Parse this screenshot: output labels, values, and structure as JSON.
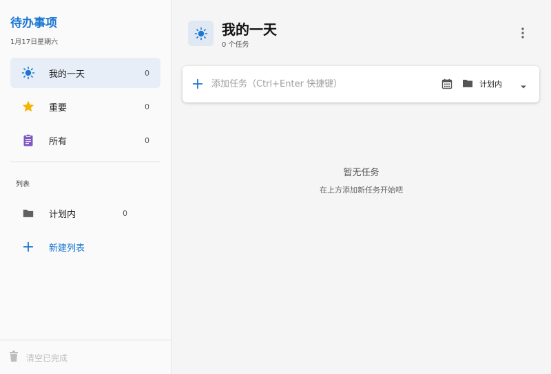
{
  "app": {
    "title": "待办事项",
    "date": "1月17日星期六"
  },
  "colors": {
    "accent": "#1976d2",
    "star": "#f5b400",
    "clipboard": "#7e57c2",
    "folder": "#616161",
    "active_bg": "#e8eef8"
  },
  "sidebar": {
    "items": [
      {
        "label": "我的一天",
        "count": "0",
        "icon": "sun-icon",
        "active": true
      },
      {
        "label": "重要",
        "count": "0",
        "icon": "star-icon",
        "active": false
      },
      {
        "label": "所有",
        "count": "0",
        "icon": "clipboard-icon",
        "active": false
      }
    ],
    "section_label": "列表",
    "lists": [
      {
        "label": "计划内",
        "count": "0",
        "icon": "folder-icon"
      }
    ],
    "new_list_label": "新建列表",
    "clear_completed_label": "清空已完成"
  },
  "main": {
    "title": "我的一天",
    "task_count": "0 个任务",
    "add_task_placeholder": "添加任务（Ctrl+Enter 快捷键）",
    "list_select_value": "计划内",
    "empty_title": "暂无任务",
    "empty_subtitle": "在上方添加新任务开始吧"
  }
}
